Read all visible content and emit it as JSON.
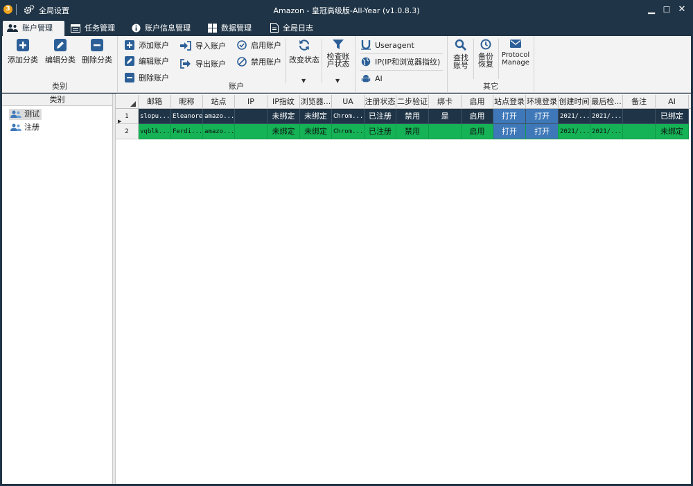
{
  "titlebar": {
    "badge": "3",
    "global_settings": "全局设置",
    "title": "Amazon - 皇冠高级版-All-Year  (v1.0.8.3)",
    "minimize": "▁",
    "maximize": "☐",
    "close": "✕"
  },
  "tabs": [
    {
      "label": "账户管理",
      "active": true,
      "icon": "users-icon"
    },
    {
      "label": "任务管理",
      "active": false,
      "icon": "task-icon"
    },
    {
      "label": "账户信息管理",
      "active": false,
      "icon": "info-icon"
    },
    {
      "label": "数据管理",
      "active": false,
      "icon": "grid-icon"
    },
    {
      "label": "全局日志",
      "active": false,
      "icon": "log-icon"
    }
  ],
  "ribbon": {
    "category": {
      "label": "类别",
      "add": "添加分类",
      "edit": "编辑分类",
      "delete": "删除分类"
    },
    "account": {
      "label": "账户",
      "add": "添加账户",
      "edit": "编辑账户",
      "delete": "删除账户",
      "import": "导入账户",
      "export": "导出账户",
      "enable": "启用账户",
      "disable": "禁用账户",
      "change_status": "改变状态",
      "check_status_1": "检查账",
      "check_status_2": "户状态"
    },
    "tools": {
      "useragent": "Useragent",
      "ip": "IP(IP和浏览器指纹)",
      "ai": "AI"
    },
    "other": {
      "label": "其它",
      "find_1": "查找",
      "find_2": "账号",
      "backup_1": "备份",
      "backup_2": "恢复",
      "protocol_1": "Protocol",
      "protocol_2": "Manage"
    }
  },
  "left_panel": {
    "header": "类别",
    "items": [
      "测试",
      "注册"
    ]
  },
  "grid": {
    "columns": [
      "邮箱",
      "昵称",
      "站点",
      "IP",
      "IP指纹",
      "浏览器...",
      "UA",
      "注册状态",
      "二步验证",
      "绑卡",
      "启用",
      "站点登录",
      "环境登录",
      "创建时间",
      "最后检...",
      "备注",
      "AI"
    ],
    "rows": [
      {
        "num": "1",
        "cells": [
          "slopu...",
          "Eleanore",
          "amazo...",
          "",
          "未绑定",
          "未绑定",
          "Chrom...",
          "已注册",
          "禁用",
          "是",
          "启用",
          "打开",
          "打开",
          "2021/...",
          "2021/...",
          "",
          "已绑定"
        ]
      },
      {
        "num": "2",
        "cells": [
          "vqblk...",
          "Ferdi...",
          "amazo...",
          "",
          "未绑定",
          "未绑定",
          "Chrom...",
          "已注册",
          "禁用",
          "",
          "启用",
          "打开",
          "打开",
          "2021/...",
          "2021/...",
          "",
          "未绑定"
        ]
      }
    ]
  }
}
